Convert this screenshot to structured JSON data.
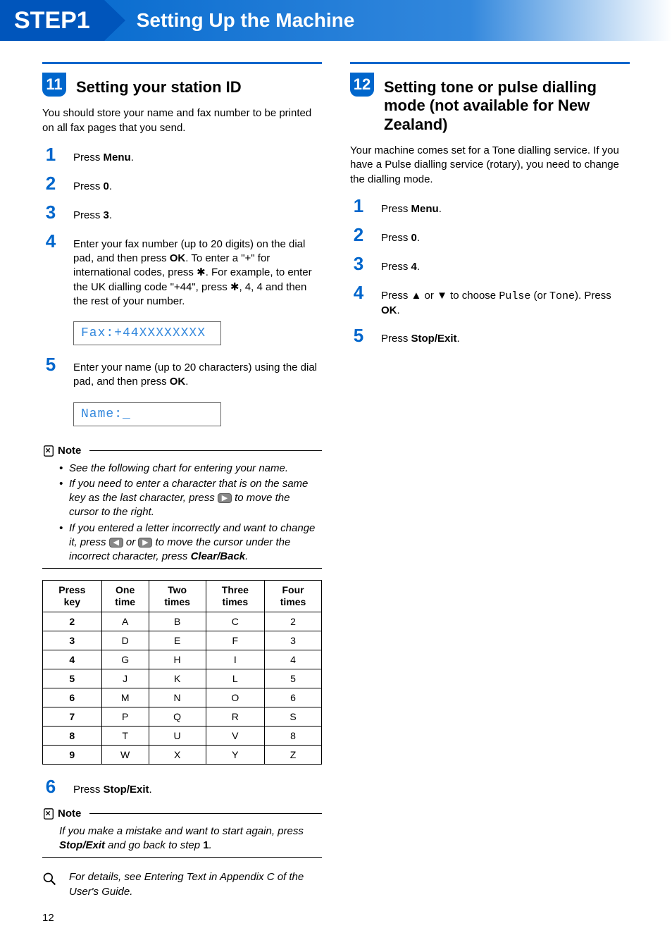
{
  "header": {
    "step": "STEP1",
    "title": "Setting Up the Machine"
  },
  "left": {
    "number": "11",
    "title": "Setting your station ID",
    "intro": "You should store your name and fax number to be printed on all fax pages that you send.",
    "steps": {
      "s1": {
        "label": "Press ",
        "bold": "Menu",
        "tail": "."
      },
      "s2": {
        "label": "Press ",
        "bold": "0",
        "tail": "."
      },
      "s3": {
        "label": "Press ",
        "bold": "3",
        "tail": "."
      },
      "s4": "Enter your fax number (up to 20 digits) on the dial pad, and then press OK. To enter a \"+\" for international codes, press ✱. For example, to enter the UK dialling code \"+44\", press ✱, 4, 4 and then the rest of your number.",
      "lcd1": "Fax:+44XXXXXXXX",
      "s5": "Enter your name (up to 20 characters) using the dial pad, and then press OK.",
      "lcd2": "Name:_",
      "s6": {
        "label": "Press ",
        "bold": "Stop/Exit",
        "tail": "."
      }
    },
    "note1_label": "Note",
    "note1_items": [
      "See the following chart for entering your name.",
      "If you need to enter a character that is on the same key as the last character, press ▶ to move the cursor to the right.",
      "If you entered a letter incorrectly and want to change it, press ◀ or ▶ to move the cursor under the incorrect character, press Clear/Back."
    ],
    "note2_label": "Note",
    "note2_text": "If you make a mistake and want to start again, press Stop/Exit and go back to step 1.",
    "reference": "For details, see Entering Text in Appendix C of the User's Guide."
  },
  "right": {
    "number": "12",
    "title": "Setting tone or pulse dialling mode (not available for New Zealand)",
    "intro": "Your machine comes set for a Tone dialling service. If you have a Pulse dialling service (rotary), you need to change the dialling mode.",
    "steps": {
      "s1": {
        "label": "Press ",
        "bold": "Menu",
        "tail": "."
      },
      "s2": {
        "label": "Press ",
        "bold": "0",
        "tail": "."
      },
      "s3": {
        "label": "Press ",
        "bold": "4",
        "tail": "."
      },
      "s4_pre": "Press ",
      "s4_mid": " or ",
      "s4_post": " to choose ",
      "s4_pulse": "Pulse",
      "s4_or": " (or ",
      "s4_tone": "Tone",
      "s4_end": "). Press ",
      "s4_ok": "OK",
      "s4_dot": ".",
      "s5": {
        "label": "Press ",
        "bold": "Stop/Exit",
        "tail": "."
      }
    }
  },
  "chart_data": {
    "type": "table",
    "headers": [
      "Press key",
      "One time",
      "Two times",
      "Three times",
      "Four times"
    ],
    "rows": [
      [
        "2",
        "A",
        "B",
        "C",
        "2"
      ],
      [
        "3",
        "D",
        "E",
        "F",
        "3"
      ],
      [
        "4",
        "G",
        "H",
        "I",
        "4"
      ],
      [
        "5",
        "J",
        "K",
        "L",
        "5"
      ],
      [
        "6",
        "M",
        "N",
        "O",
        "6"
      ],
      [
        "7",
        "P",
        "Q",
        "R",
        "S"
      ],
      [
        "8",
        "T",
        "U",
        "V",
        "8"
      ],
      [
        "9",
        "W",
        "X",
        "Y",
        "Z"
      ]
    ]
  },
  "page_number": "12"
}
